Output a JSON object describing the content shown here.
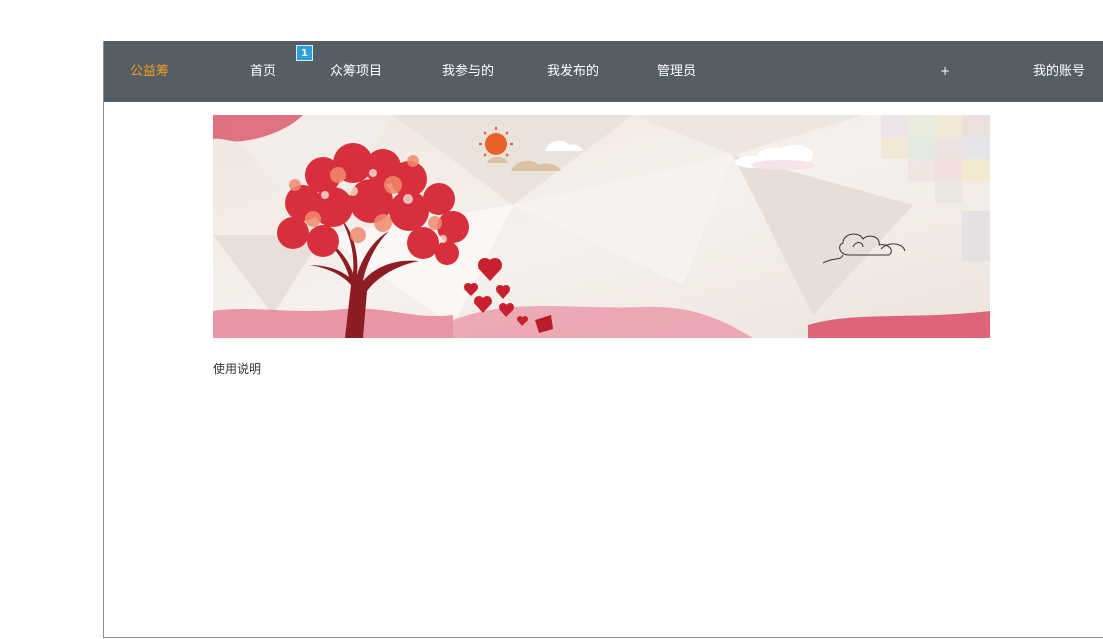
{
  "navbar": {
    "brand": "公益筹",
    "items": [
      {
        "label": "首页"
      },
      {
        "label": "众筹项目"
      },
      {
        "label": "我参与的"
      },
      {
        "label": "我发布的"
      },
      {
        "label": "管理员"
      }
    ],
    "badge": "1",
    "plus": "+",
    "account": "我的账号"
  },
  "colors": {
    "navbar_bg": "#555d65",
    "brand": "#f0a020",
    "badge_bg": "#2a9fd8"
  },
  "banner": {
    "icons": [
      "heart-tree-illustration",
      "sun-icon",
      "cloud-icon",
      "ink-cloud-icon"
    ]
  },
  "main": {
    "usage_link": "使用说明"
  }
}
